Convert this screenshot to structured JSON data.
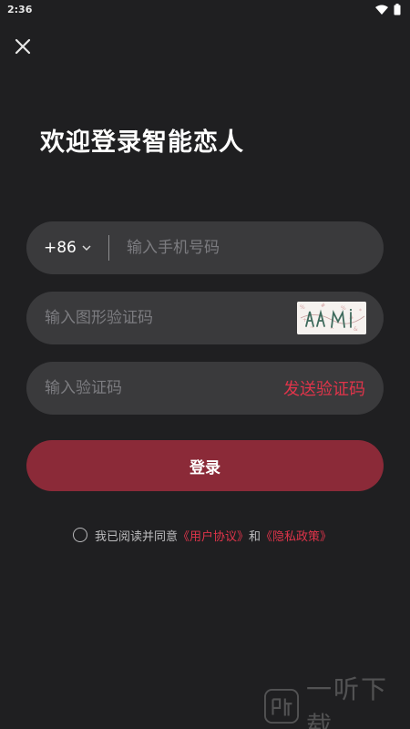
{
  "status_bar": {
    "time": "2:36",
    "icons": [
      "wifi-icon",
      "battery-icon"
    ]
  },
  "header": {
    "close_icon": "close-icon",
    "title": "欢迎登录智能恋人"
  },
  "form": {
    "phone": {
      "country_code": "+86",
      "country_code_icon": "chevron-down-icon",
      "placeholder": "输入手机号码",
      "value": ""
    },
    "image_captcha": {
      "placeholder": "输入图形验证码",
      "value": "",
      "captcha_image": "captcha-image"
    },
    "sms_code": {
      "placeholder": "输入验证码",
      "value": "",
      "send_label": "发送验证码"
    },
    "login_label": "登录"
  },
  "agreement": {
    "checked": false,
    "prefix": "我已阅读并同意",
    "user_agreement": "《用户协议》",
    "conjunction": "和",
    "privacy_policy": "《隐私政策》"
  },
  "colors": {
    "background": "#1f1f21",
    "field": "#3a3a3c",
    "accent": "#e0344a",
    "button": "#8b2a38"
  }
}
